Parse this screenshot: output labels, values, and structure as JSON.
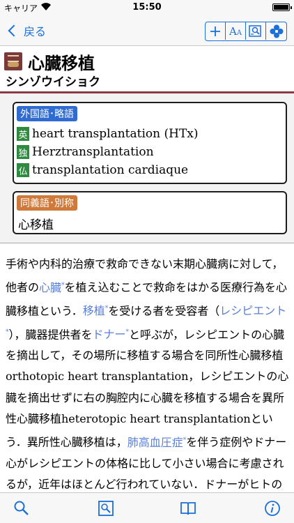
{
  "status_bar": {
    "carrier": "キャリア",
    "time": "15:50"
  },
  "nav": {
    "back_label": "戻る",
    "font_size_label": "A",
    "font_size_sub": "A"
  },
  "entry": {
    "title": "心臓移植",
    "reading": "シンゾウイショク"
  },
  "foreign_terms": {
    "label": "外国語･略語",
    "items": [
      {
        "tag": "英",
        "text": "heart transplantation (HTx)"
      },
      {
        "tag": "独",
        "text": "Herztransplantation"
      },
      {
        "tag": "仏",
        "text": "transplantation cardiaque"
      }
    ]
  },
  "synonyms": {
    "label": "同義語･別称",
    "text": "心移植"
  },
  "body": {
    "s1": "手術や内科的治療で救命できない末期心臓病に対して，他者の",
    "link_heart": "心臓",
    "s2": "を植え込むことで救命をはかる医療行為を心臓移植という．",
    "link_graft": "移植",
    "s3": "を受ける者を受容者（",
    "link_recipient": "レシピエント",
    "s4": "），臓器提供者を",
    "link_donor": "ドナー",
    "s5": "と呼ぶが，レシピエントの心臓を摘出して，その場所に移植する場合を同所性心臓移植orthotopic heart transplantation，レシピエントの心臓を摘出せずに右の胸腔内に心臓を移植する場合を異所性心臓移植heterotopic heart transplantationという．異所性心臓移植は，",
    "link_hypertension": "肺高血圧症",
    "s6": "を伴う症例やドナー心がレシピエントの体格に比して小さい場合に考慮されるが，近年はほとんど行われていない．ドナーがヒトの場合の心臓移植を同種心臓移植",
    "link_mark": "*"
  },
  "icons": {
    "back": "chevron-left-icon",
    "zoom_in": "plus-icon",
    "font_size": "font-size-icon",
    "search_in_page": "search-document-icon",
    "settings": "clover-icon",
    "tab_search": "search-icon",
    "tab_image_search": "image-search-icon",
    "tab_book": "book-icon",
    "tab_info": "info-icon"
  },
  "colors": {
    "accent": "#1a6fd8",
    "header_rule": "#8a3a48",
    "foreign_label": "#2f6bd0",
    "synonym_label": "#cf7a3a",
    "lang_tag": "#2e8a3e",
    "link": "#5a7fd8"
  }
}
